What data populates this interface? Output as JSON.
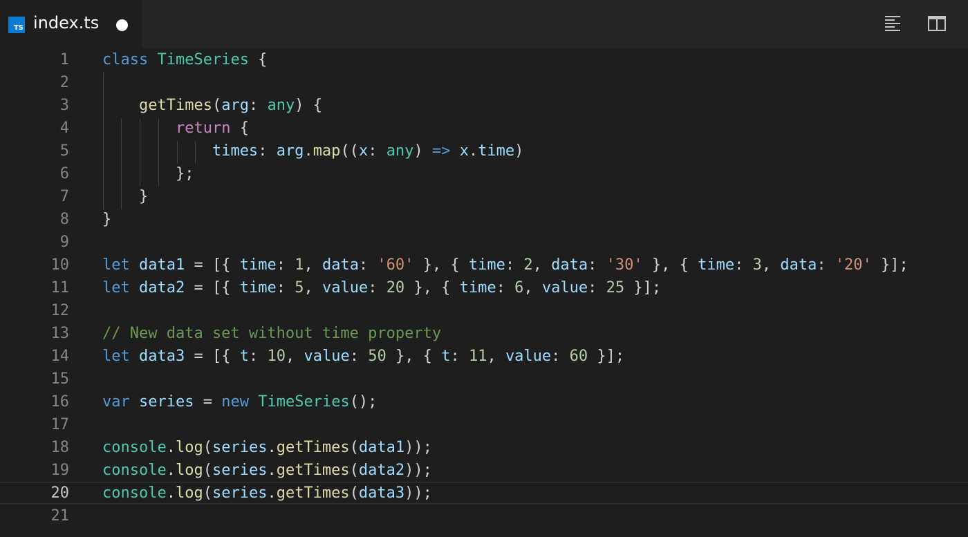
{
  "tab": {
    "icon_label": "TS",
    "title": "index.ts",
    "modified_indicator": "dirty-dot-icon"
  },
  "actions": [
    {
      "name": "open-outline-icon"
    },
    {
      "name": "split-editor-icon"
    }
  ],
  "colors": {
    "background": "#1e1e1e",
    "tabbar": "#252526",
    "ts_icon": "#0e7bd1",
    "keyword": "#569cd6",
    "control": "#c586c0",
    "class": "#4ec9b0",
    "function": "#dcdcaa",
    "variable": "#9cdcfe",
    "number": "#b5cea8",
    "string": "#ce9178",
    "comment": "#6a9955"
  },
  "editor": {
    "current_line": 20,
    "lines": [
      {
        "n": "1",
        "tokens": [
          [
            "kw",
            "class"
          ],
          [
            "plain",
            " "
          ],
          [
            "cls",
            "TimeSeries"
          ],
          [
            "plain",
            " {"
          ]
        ]
      },
      {
        "n": "2",
        "tokens": []
      },
      {
        "n": "3",
        "tokens": [
          [
            "plain",
            "    "
          ],
          [
            "fn",
            "getTimes"
          ],
          [
            "plain",
            "("
          ],
          [
            "var",
            "arg"
          ],
          [
            "plain",
            ": "
          ],
          [
            "cls",
            "any"
          ],
          [
            "plain",
            ") {"
          ]
        ]
      },
      {
        "n": "4",
        "tokens": [
          [
            "plain",
            "        "
          ],
          [
            "ctl",
            "return"
          ],
          [
            "plain",
            " {"
          ]
        ]
      },
      {
        "n": "5",
        "tokens": [
          [
            "plain",
            "            "
          ],
          [
            "var",
            "times"
          ],
          [
            "plain",
            ": "
          ],
          [
            "var",
            "arg"
          ],
          [
            "plain",
            "."
          ],
          [
            "fn",
            "map"
          ],
          [
            "plain",
            "(("
          ],
          [
            "var",
            "x"
          ],
          [
            "plain",
            ": "
          ],
          [
            "cls",
            "any"
          ],
          [
            "plain",
            ") "
          ],
          [
            "kw",
            "=>"
          ],
          [
            "plain",
            " "
          ],
          [
            "var",
            "x"
          ],
          [
            "plain",
            "."
          ],
          [
            "var",
            "time"
          ],
          [
            "plain",
            ")"
          ]
        ]
      },
      {
        "n": "6",
        "tokens": [
          [
            "plain",
            "        };"
          ]
        ]
      },
      {
        "n": "7",
        "tokens": [
          [
            "plain",
            "    }"
          ]
        ]
      },
      {
        "n": "8",
        "tokens": [
          [
            "plain",
            "}"
          ]
        ]
      },
      {
        "n": "9",
        "tokens": []
      },
      {
        "n": "10",
        "tokens": [
          [
            "kw",
            "let"
          ],
          [
            "plain",
            " "
          ],
          [
            "var",
            "data1"
          ],
          [
            "plain",
            " = [{ "
          ],
          [
            "var",
            "time"
          ],
          [
            "plain",
            ": "
          ],
          [
            "num",
            "1"
          ],
          [
            "plain",
            ", "
          ],
          [
            "var",
            "data"
          ],
          [
            "plain",
            ": "
          ],
          [
            "str",
            "'60'"
          ],
          [
            "plain",
            " }, { "
          ],
          [
            "var",
            "time"
          ],
          [
            "plain",
            ": "
          ],
          [
            "num",
            "2"
          ],
          [
            "plain",
            ", "
          ],
          [
            "var",
            "data"
          ],
          [
            "plain",
            ": "
          ],
          [
            "str",
            "'30'"
          ],
          [
            "plain",
            " }, { "
          ],
          [
            "var",
            "time"
          ],
          [
            "plain",
            ": "
          ],
          [
            "num",
            "3"
          ],
          [
            "plain",
            ", "
          ],
          [
            "var",
            "data"
          ],
          [
            "plain",
            ": "
          ],
          [
            "str",
            "'20'"
          ],
          [
            "plain",
            " }];"
          ]
        ]
      },
      {
        "n": "11",
        "tokens": [
          [
            "kw",
            "let"
          ],
          [
            "plain",
            " "
          ],
          [
            "var",
            "data2"
          ],
          [
            "plain",
            " = [{ "
          ],
          [
            "var",
            "time"
          ],
          [
            "plain",
            ": "
          ],
          [
            "num",
            "5"
          ],
          [
            "plain",
            ", "
          ],
          [
            "var",
            "value"
          ],
          [
            "plain",
            ": "
          ],
          [
            "num",
            "20"
          ],
          [
            "plain",
            " }, { "
          ],
          [
            "var",
            "time"
          ],
          [
            "plain",
            ": "
          ],
          [
            "num",
            "6"
          ],
          [
            "plain",
            ", "
          ],
          [
            "var",
            "value"
          ],
          [
            "plain",
            ": "
          ],
          [
            "num",
            "25"
          ],
          [
            "plain",
            " }];"
          ]
        ]
      },
      {
        "n": "12",
        "tokens": []
      },
      {
        "n": "13",
        "tokens": [
          [
            "cmt",
            "// New data set without time property"
          ]
        ]
      },
      {
        "n": "14",
        "tokens": [
          [
            "kw",
            "let"
          ],
          [
            "plain",
            " "
          ],
          [
            "var",
            "data3"
          ],
          [
            "plain",
            " = [{ "
          ],
          [
            "var",
            "t"
          ],
          [
            "plain",
            ": "
          ],
          [
            "num",
            "10"
          ],
          [
            "plain",
            ", "
          ],
          [
            "var",
            "value"
          ],
          [
            "plain",
            ": "
          ],
          [
            "num",
            "50"
          ],
          [
            "plain",
            " }, { "
          ],
          [
            "var",
            "t"
          ],
          [
            "plain",
            ": "
          ],
          [
            "num",
            "11"
          ],
          [
            "plain",
            ", "
          ],
          [
            "var",
            "value"
          ],
          [
            "plain",
            ": "
          ],
          [
            "num",
            "60"
          ],
          [
            "plain",
            " }];"
          ]
        ]
      },
      {
        "n": "15",
        "tokens": []
      },
      {
        "n": "16",
        "tokens": [
          [
            "kw",
            "var"
          ],
          [
            "plain",
            " "
          ],
          [
            "var",
            "series"
          ],
          [
            "plain",
            " = "
          ],
          [
            "kw",
            "new"
          ],
          [
            "plain",
            " "
          ],
          [
            "cls",
            "TimeSeries"
          ],
          [
            "plain",
            "();"
          ]
        ]
      },
      {
        "n": "17",
        "tokens": []
      },
      {
        "n": "18",
        "tokens": [
          [
            "cls",
            "console"
          ],
          [
            "plain",
            "."
          ],
          [
            "fn",
            "log"
          ],
          [
            "plain",
            "("
          ],
          [
            "var",
            "series"
          ],
          [
            "plain",
            "."
          ],
          [
            "fn",
            "getTimes"
          ],
          [
            "plain",
            "("
          ],
          [
            "var",
            "data1"
          ],
          [
            "plain",
            "));"
          ]
        ]
      },
      {
        "n": "19",
        "tokens": [
          [
            "cls",
            "console"
          ],
          [
            "plain",
            "."
          ],
          [
            "fn",
            "log"
          ],
          [
            "plain",
            "("
          ],
          [
            "var",
            "series"
          ],
          [
            "plain",
            "."
          ],
          [
            "fn",
            "getTimes"
          ],
          [
            "plain",
            "("
          ],
          [
            "var",
            "data2"
          ],
          [
            "plain",
            "));"
          ]
        ]
      },
      {
        "n": "20",
        "tokens": [
          [
            "cls",
            "console"
          ],
          [
            "plain",
            "."
          ],
          [
            "fn",
            "log"
          ],
          [
            "plain",
            "("
          ],
          [
            "var",
            "series"
          ],
          [
            "plain",
            "."
          ],
          [
            "fn",
            "getTimes"
          ],
          [
            "plain",
            "("
          ],
          [
            "var",
            "data3"
          ],
          [
            "plain",
            "));"
          ]
        ]
      },
      {
        "n": "21",
        "tokens": []
      }
    ]
  }
}
